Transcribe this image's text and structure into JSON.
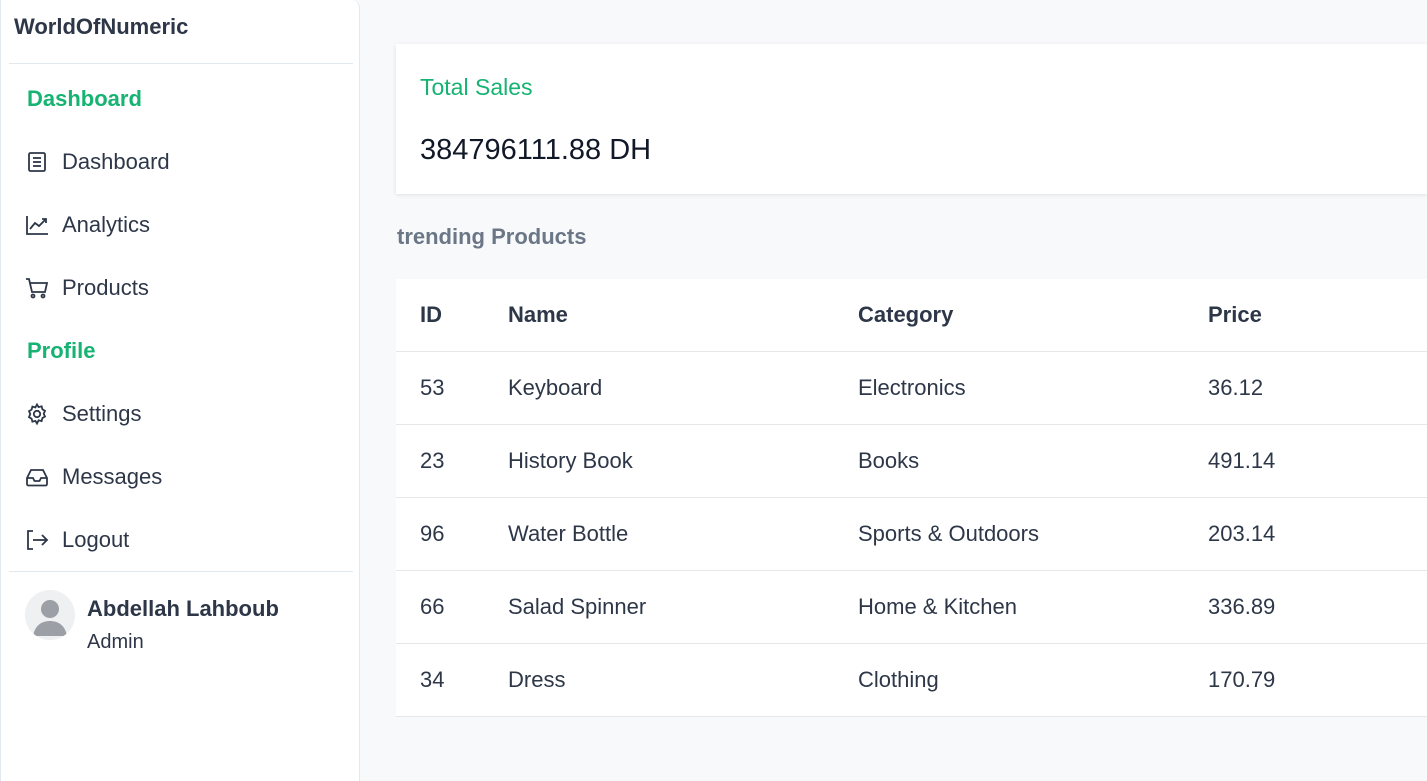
{
  "brand": "WorldOfNumeric",
  "colors": {
    "accent": "#16b372",
    "text": "#2d3748",
    "muted": "#6b7787"
  },
  "sidebar": {
    "sections": [
      {
        "heading": "Dashboard"
      },
      {
        "heading": "Profile"
      }
    ],
    "items": [
      {
        "label": "Dashboard",
        "icon": "document-icon"
      },
      {
        "label": "Analytics",
        "icon": "chart-line-icon"
      },
      {
        "label": "Products",
        "icon": "cart-icon"
      },
      {
        "label": "Settings",
        "icon": "gear-icon"
      },
      {
        "label": "Messages",
        "icon": "inbox-icon"
      },
      {
        "label": "Logout",
        "icon": "logout-icon"
      }
    ]
  },
  "user": {
    "name": "Abdellah Lahboub",
    "role": "Admin"
  },
  "summary": {
    "title": "Total Sales",
    "value": "384796111.88 DH"
  },
  "trending": {
    "title": "trending Products",
    "columns": [
      "ID",
      "Name",
      "Category",
      "Price"
    ],
    "rows": [
      [
        "53",
        "Keyboard",
        "Electronics",
        "36.12"
      ],
      [
        "23",
        "History Book",
        "Books",
        "491.14"
      ],
      [
        "96",
        "Water Bottle",
        "Sports & Outdoors",
        "203.14"
      ],
      [
        "66",
        "Salad Spinner",
        "Home & Kitchen",
        "336.89"
      ],
      [
        "34",
        "Dress",
        "Clothing",
        "170.79"
      ]
    ]
  }
}
